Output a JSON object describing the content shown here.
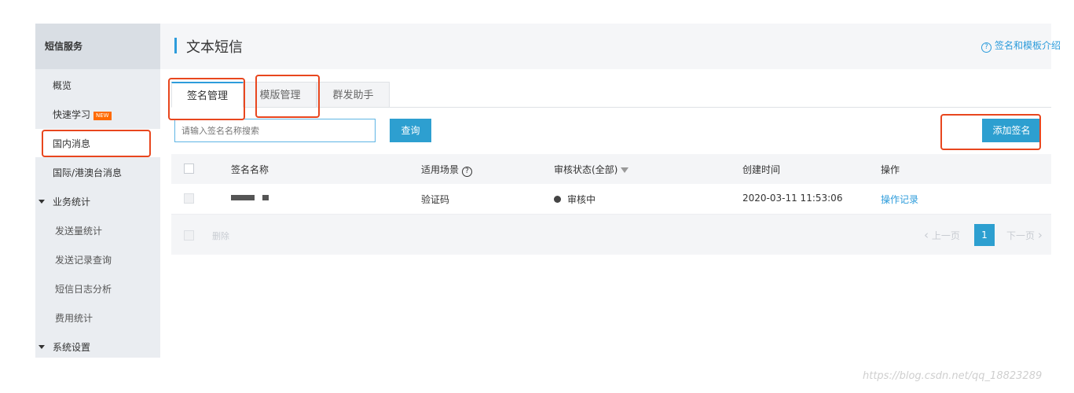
{
  "sidebar": {
    "header": "短信服务",
    "items": [
      {
        "label": "概览"
      },
      {
        "label": "快速学习",
        "badge": "NEW"
      },
      {
        "label": "国内消息"
      },
      {
        "label": "国际/港澳台消息"
      }
    ],
    "section_stats": "业务统计",
    "stats_items": [
      "发送量统计",
      "发送记录查询",
      "短信日志分析",
      "费用统计"
    ],
    "section_settings": "系统设置"
  },
  "header": {
    "title": "文本短信",
    "help_link": "签名和模板介绍"
  },
  "tabs": [
    "签名管理",
    "模版管理",
    "群发助手"
  ],
  "search": {
    "placeholder": "请输入签名名称搜索",
    "button": "查询"
  },
  "add_button": "添加签名",
  "table": {
    "columns": {
      "name": "签名名称",
      "scene": "适用场景",
      "status": "审核状态(全部)",
      "created": "创建时间",
      "action": "操作"
    },
    "rows": [
      {
        "scene": "验证码",
        "status": "审核中",
        "created": "2020-03-11 11:53:06",
        "action": "操作记录"
      }
    ]
  },
  "footer": {
    "delete": "删除",
    "prev": "上一页",
    "page": "1",
    "next": "下一页"
  },
  "watermark": "https://blog.csdn.net/qq_18823289",
  "colors": {
    "accent": "#2d9cdb",
    "annotation": "#e8461e"
  }
}
